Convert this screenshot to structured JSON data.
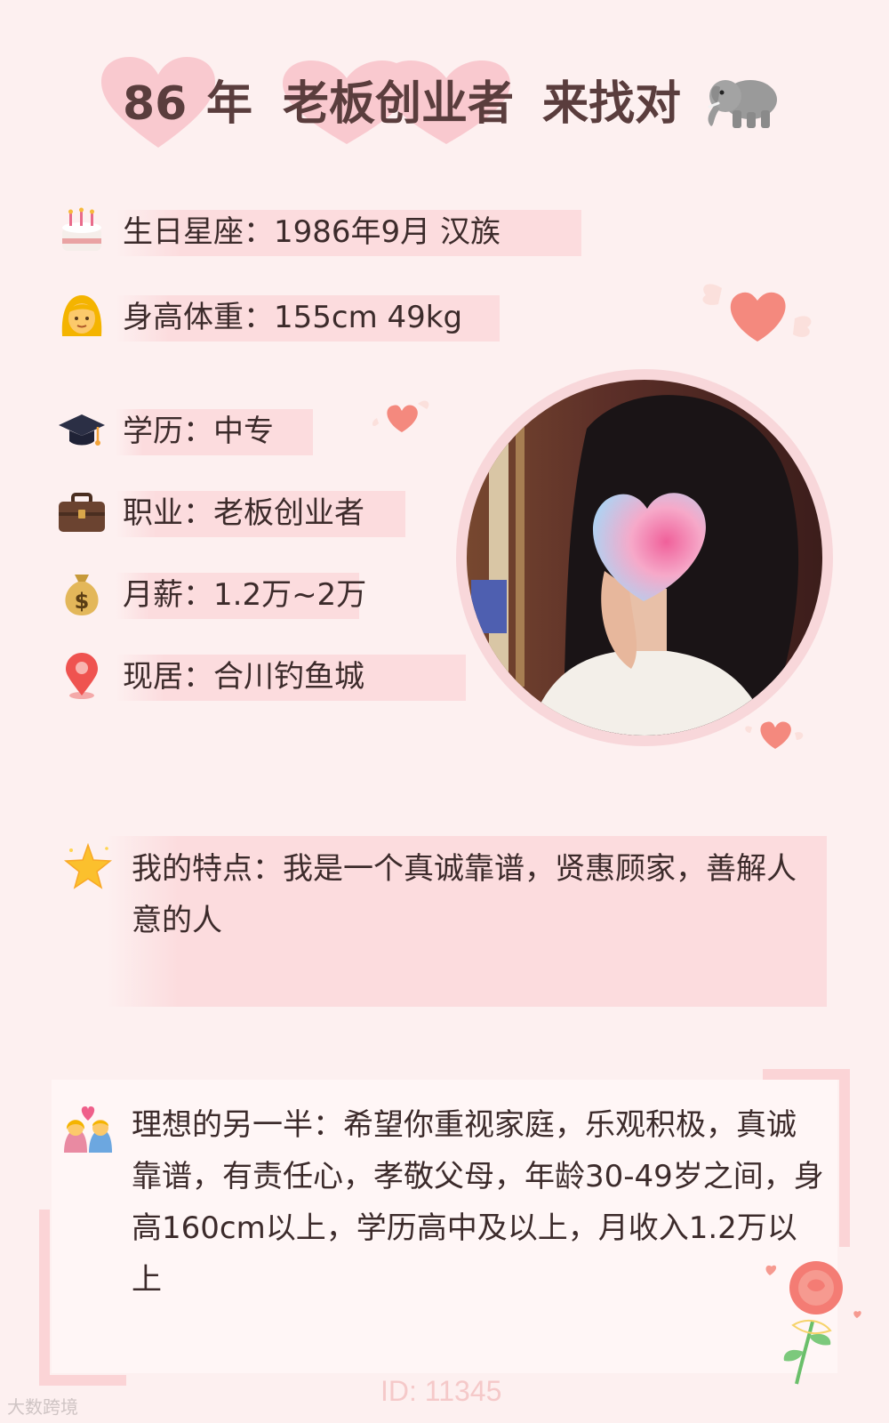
{
  "header": {
    "age": "86",
    "year_label": "年",
    "occupation": "老板创业者",
    "seeking": "来找对",
    "emoji_icon": "elephant-icon"
  },
  "profile": {
    "birthday": {
      "icon": "birthday-cake-icon",
      "text": "生日星座：1986年9月 汉族"
    },
    "height_weight": {
      "icon": "woman-face-icon",
      "text": "身高体重：155cm 49kg"
    },
    "education": {
      "icon": "graduation-cap-icon",
      "text": "学历：中专"
    },
    "job": {
      "icon": "briefcase-icon",
      "text": "职业：老板创业者"
    },
    "salary": {
      "icon": "money-bag-icon",
      "text": "月薪：1.2万~2万"
    },
    "residence": {
      "icon": "location-pin-icon",
      "text": "现居：合川钓鱼城"
    }
  },
  "feature": {
    "icon": "star-icon",
    "text": "我的特点：我是一个真诚靠谱，贤惠顾家，善解人意的人"
  },
  "ideal_partner": {
    "icon": "couple-heart-icon",
    "text": "理想的另一半：希望你重视家庭，乐观积极，真诚靠谱，有责任心，孝敬父母，年龄30-49岁之间，身高160cm以上，学历高中及以上，月收入1.2万以上"
  },
  "footer": {
    "id_text": "ID: 11345",
    "watermark": "大数跨境"
  },
  "colors": {
    "background": "#fdf0f0",
    "bar": "#fcdcde",
    "heart": "#f9c6cc",
    "title_text": "#5a3d3d",
    "accent_heart": "#f4897e"
  }
}
